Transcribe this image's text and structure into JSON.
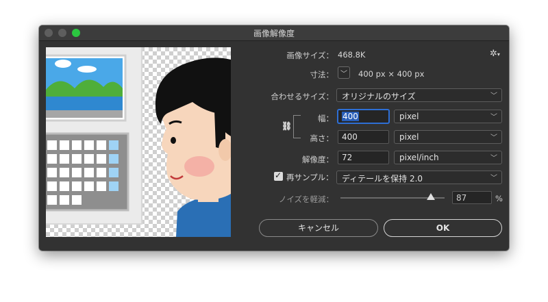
{
  "window": {
    "title": "画像解像度"
  },
  "image_size": {
    "label": "画像サイズ：",
    "value": "468.8K"
  },
  "dimensions": {
    "label": "寸法：",
    "value": "400 px × 400 px"
  },
  "fit_to": {
    "label": "合わせるサイズ：",
    "value": "オリジナルのサイズ"
  },
  "width": {
    "label": "幅：",
    "value": "400",
    "unit": "pixel"
  },
  "height": {
    "label": "高さ：",
    "value": "400",
    "unit": "pixel"
  },
  "resolution": {
    "label": "解像度：",
    "value": "72",
    "unit": "pixel/inch"
  },
  "resample": {
    "label": "再サンプル：",
    "checked": true,
    "method": "ディテールを保持 2.0"
  },
  "noise": {
    "label": "ノイズを軽減：",
    "value": "87",
    "unit": "%",
    "slider_fraction": 0.87
  },
  "buttons": {
    "cancel": "キャンセル",
    "ok": "OK"
  },
  "icons": {
    "settings": "gear-icon",
    "link": "chain-link-icon",
    "check": "checkmark-icon",
    "dropdown": "chevron-down-icon"
  },
  "colors": {
    "accent": "#2e6fd6",
    "dialog_bg": "#323232",
    "max_button": "#2bc740"
  }
}
